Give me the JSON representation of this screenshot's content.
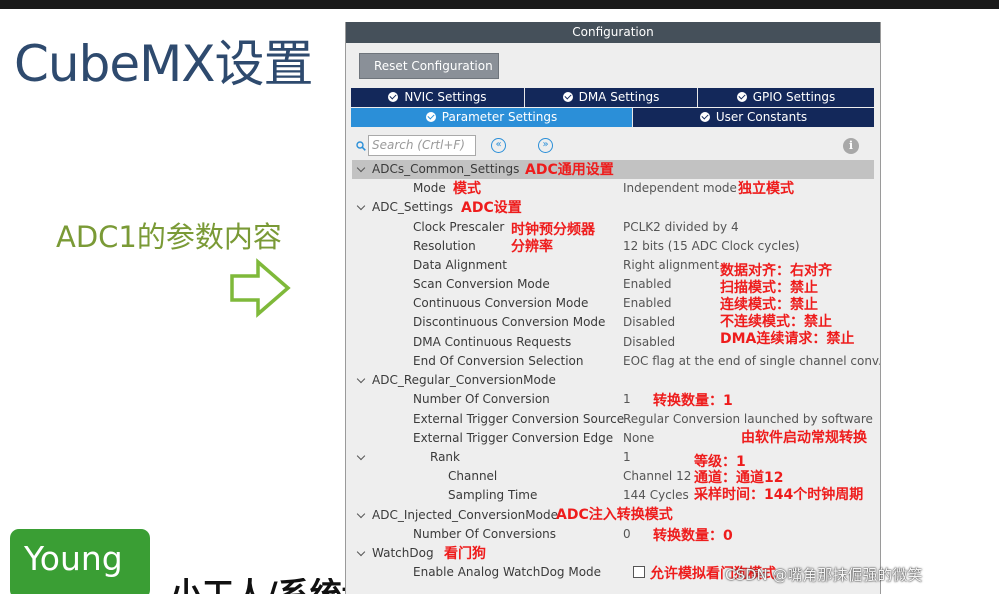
{
  "slide": {
    "title": "CubeMX设置",
    "subtitle": "ADC1的参数内容",
    "badge_text": "Young",
    "bottom_text": "小工人/系统设置DMA功能以上相关",
    "watermark": "CSDN @嘴角那抹倔强的微笑"
  },
  "panel": {
    "header": "Configuration",
    "reset_button": "Reset Configuration",
    "tabs": [
      {
        "label": "NVIC Settings"
      },
      {
        "label": "DMA Settings"
      },
      {
        "label": "GPIO Settings"
      },
      {
        "label": "Parameter Settings"
      },
      {
        "label": "User Constants"
      }
    ],
    "search_placeholder": "Search (Crtl+F)",
    "info": "i"
  },
  "tree": [
    {
      "type": "group",
      "label": "ADCs_Common_Settings"
    },
    {
      "type": "param",
      "label": "Mode",
      "value": "Independent mode"
    },
    {
      "type": "group",
      "label": "ADC_Settings"
    },
    {
      "type": "param",
      "label": "Clock Prescaler",
      "value": "PCLK2 divided by 4"
    },
    {
      "type": "param",
      "label": "Resolution",
      "value": "12 bits (15 ADC Clock cycles)"
    },
    {
      "type": "param",
      "label": "Data Alignment",
      "value": "Right alignment"
    },
    {
      "type": "param",
      "label": "Scan Conversion Mode",
      "value": "Enabled"
    },
    {
      "type": "param",
      "label": "Continuous Conversion Mode",
      "value": "Enabled"
    },
    {
      "type": "param",
      "label": "Discontinuous Conversion Mode",
      "value": "Disabled"
    },
    {
      "type": "param",
      "label": "DMA Continuous Requests",
      "value": "Disabled"
    },
    {
      "type": "param",
      "label": "End Of Conversion Selection",
      "value": "EOC flag at the end of single channel conv..."
    },
    {
      "type": "group",
      "label": "ADC_Regular_ConversionMode"
    },
    {
      "type": "param",
      "label": "Number Of Conversion",
      "value": "1"
    },
    {
      "type": "param",
      "label": "External Trigger Conversion Source",
      "value": "Regular Conversion launched by software"
    },
    {
      "type": "param",
      "label": "External Trigger Conversion Edge",
      "value": "None"
    },
    {
      "type": "param",
      "label": "Rank",
      "value": "1"
    },
    {
      "type": "param",
      "label": "Channel",
      "value": "Channel 12"
    },
    {
      "type": "param",
      "label": "Sampling Time",
      "value": "144 Cycles"
    },
    {
      "type": "group",
      "label": "ADC_Injected_ConversionMode"
    },
    {
      "type": "param",
      "label": "Number Of Conversions",
      "value": "0"
    },
    {
      "type": "group",
      "label": "WatchDog"
    },
    {
      "type": "param",
      "label": "Enable Analog WatchDog Mode",
      "value": ""
    }
  ],
  "annotations": {
    "common": "ADC通用设置",
    "mode": "模式",
    "independent": "独立模式",
    "adc_settings": "ADC设置",
    "prescaler": "时钟预分频器",
    "resolution": "分辨率",
    "align": "数据对齐：右对齐",
    "scan": "扫描模式：禁止",
    "continuous": "连续模式：禁止",
    "discontinuous": "不连续模式：禁止",
    "dma": "DMA连续请求：禁止",
    "num_conv": "转换数量：1",
    "software": "由软件启动常规转换",
    "rank": "等级：1",
    "channel": "通道：通道12",
    "sampling": "采样时间：144个时钟周期",
    "injected": "ADC注入转换模式",
    "num_conv0": "转换数量：0",
    "watchdog": "看门狗",
    "analog_wd": "允许模拟看门狗模式"
  },
  "colors": {
    "panel_header": "#45505a",
    "tab_dark": "#13285a",
    "tab_active": "#2b8fd8",
    "annotation": "#ee1c1c",
    "title": "#2e4a6e",
    "subtitle": "#7a9a36",
    "badge": "#3a9e34"
  }
}
